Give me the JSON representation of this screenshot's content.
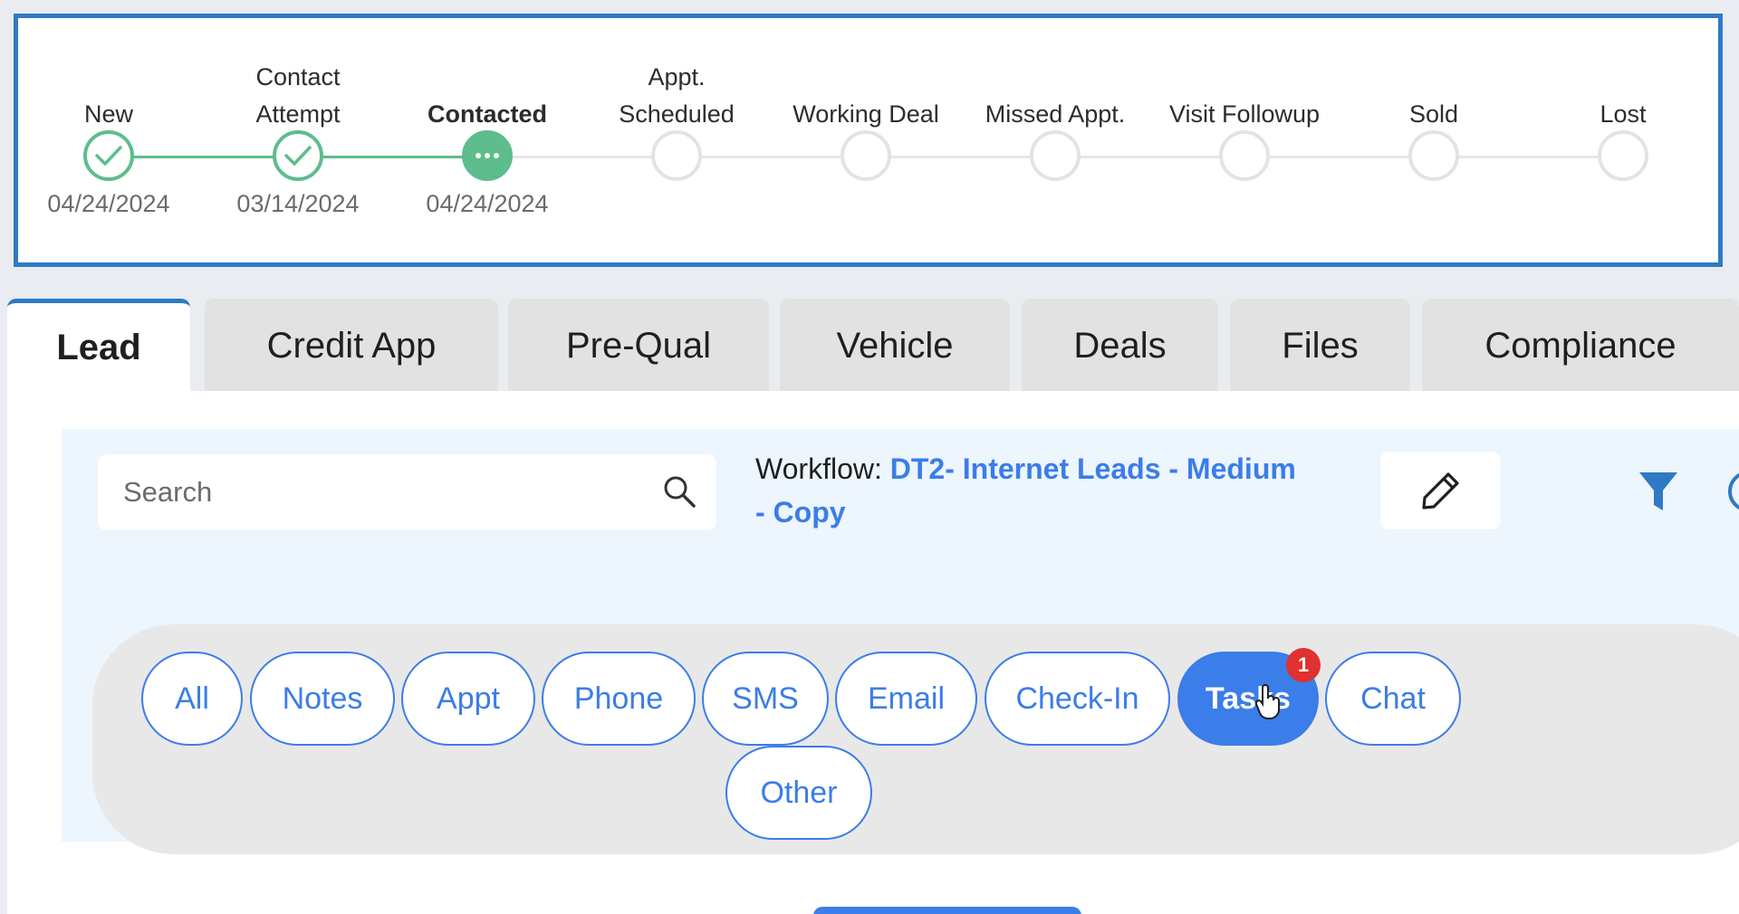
{
  "progress": {
    "stages": [
      {
        "label": "New",
        "date": "04/24/2024",
        "state": "done",
        "icon": "check-icon"
      },
      {
        "label": "Contact Attempt",
        "date": "03/14/2024",
        "state": "done",
        "icon": "check-icon"
      },
      {
        "label": "Contacted",
        "date": "04/24/2024",
        "state": "current",
        "icon": "ellipsis-icon"
      },
      {
        "label": "Appt. Scheduled",
        "date": "",
        "state": "pending"
      },
      {
        "label": "Working Deal",
        "date": "",
        "state": "pending"
      },
      {
        "label": "Missed Appt.",
        "date": "",
        "state": "pending"
      },
      {
        "label": "Visit Followup",
        "date": "",
        "state": "pending"
      },
      {
        "label": "Sold",
        "date": "",
        "state": "pending"
      },
      {
        "label": "Lost",
        "date": "",
        "state": "pending"
      }
    ]
  },
  "tabs": [
    {
      "label": "Lead",
      "active": true
    },
    {
      "label": "Credit App"
    },
    {
      "label": "Pre-Qual"
    },
    {
      "label": "Vehicle"
    },
    {
      "label": "Deals"
    },
    {
      "label": "Files"
    },
    {
      "label": "Compliance"
    }
  ],
  "toolbar": {
    "search_placeholder": "Search",
    "workflow_label": "Workflow:",
    "workflow_name": "DT2- Internet Leads - Medium - Copy"
  },
  "filters": [
    {
      "label": "All"
    },
    {
      "label": "Notes"
    },
    {
      "label": "Appt"
    },
    {
      "label": "Phone"
    },
    {
      "label": "SMS"
    },
    {
      "label": "Email"
    },
    {
      "label": "Check-In"
    },
    {
      "label": "Tasks",
      "active": true,
      "badge": "1"
    },
    {
      "label": "Chat"
    },
    {
      "label": "Other"
    }
  ],
  "colors": {
    "accent": "#3b7de9",
    "frame": "#2f7ac4",
    "done": "#5dbd8c",
    "badge": "#e0302f"
  }
}
